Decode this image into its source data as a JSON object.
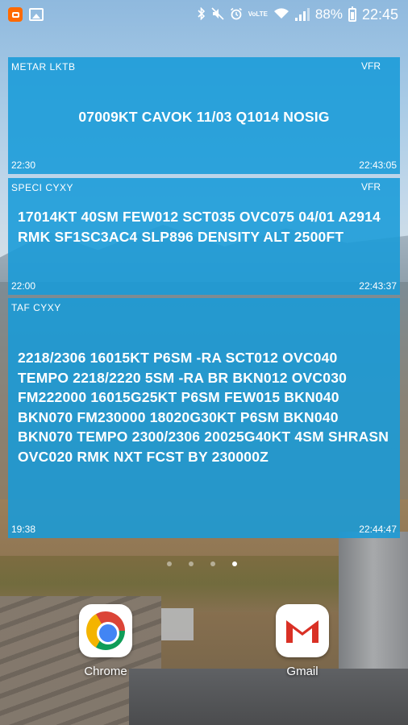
{
  "status_bar": {
    "battery_percent": "88%",
    "time": "22:45",
    "volte_label": "VoLTE",
    "icons": [
      "app-notification-icon",
      "gallery-icon",
      "bluetooth-icon",
      "mute-icon",
      "alarm-icon",
      "volte-icon",
      "wifi-icon",
      "signal-icon",
      "battery-icon"
    ]
  },
  "widgets": [
    {
      "title": "METAR LKTB",
      "flight_rules": "VFR",
      "report": "07009KT CAVOK 11/03 Q1014 NOSIG",
      "observed": "22:30",
      "updated": "22:43:05"
    },
    {
      "title": "SPECI CYXY",
      "flight_rules": "VFR",
      "report": "17014KT 40SM FEW012 SCT035 OVC075 04/01 A2914 RMK SF1SC3AC4 SLP896 DENSITY ALT 2500FT",
      "observed": "22:00",
      "updated": "22:43:37"
    },
    {
      "title": "TAF CYXY",
      "flight_rules": "",
      "report": "2218/2306 16015KT P6SM -RA SCT012 OVC040 TEMPO 2218/2220 5SM -RA BR BKN012 OVC030 FM222000 16015G25KT P6SM FEW015 BKN040 BKN070 FM230000 18020G30KT P6SM BKN040 BKN070 TEMPO 2300/2306 20025G40KT 4SM SHRASN OVC020 RMK NXT FCST BY 230000Z",
      "observed": "19:38",
      "updated": "22:44:47"
    }
  ],
  "pager": {
    "pages": 4,
    "active_index": 3
  },
  "apps": [
    {
      "label": "Chrome",
      "icon": "chrome-icon"
    },
    {
      "label": "Gmail",
      "icon": "gmail-icon"
    }
  ],
  "colors": {
    "widget_background": "#189bd8",
    "gmail_red": "#d93025"
  }
}
